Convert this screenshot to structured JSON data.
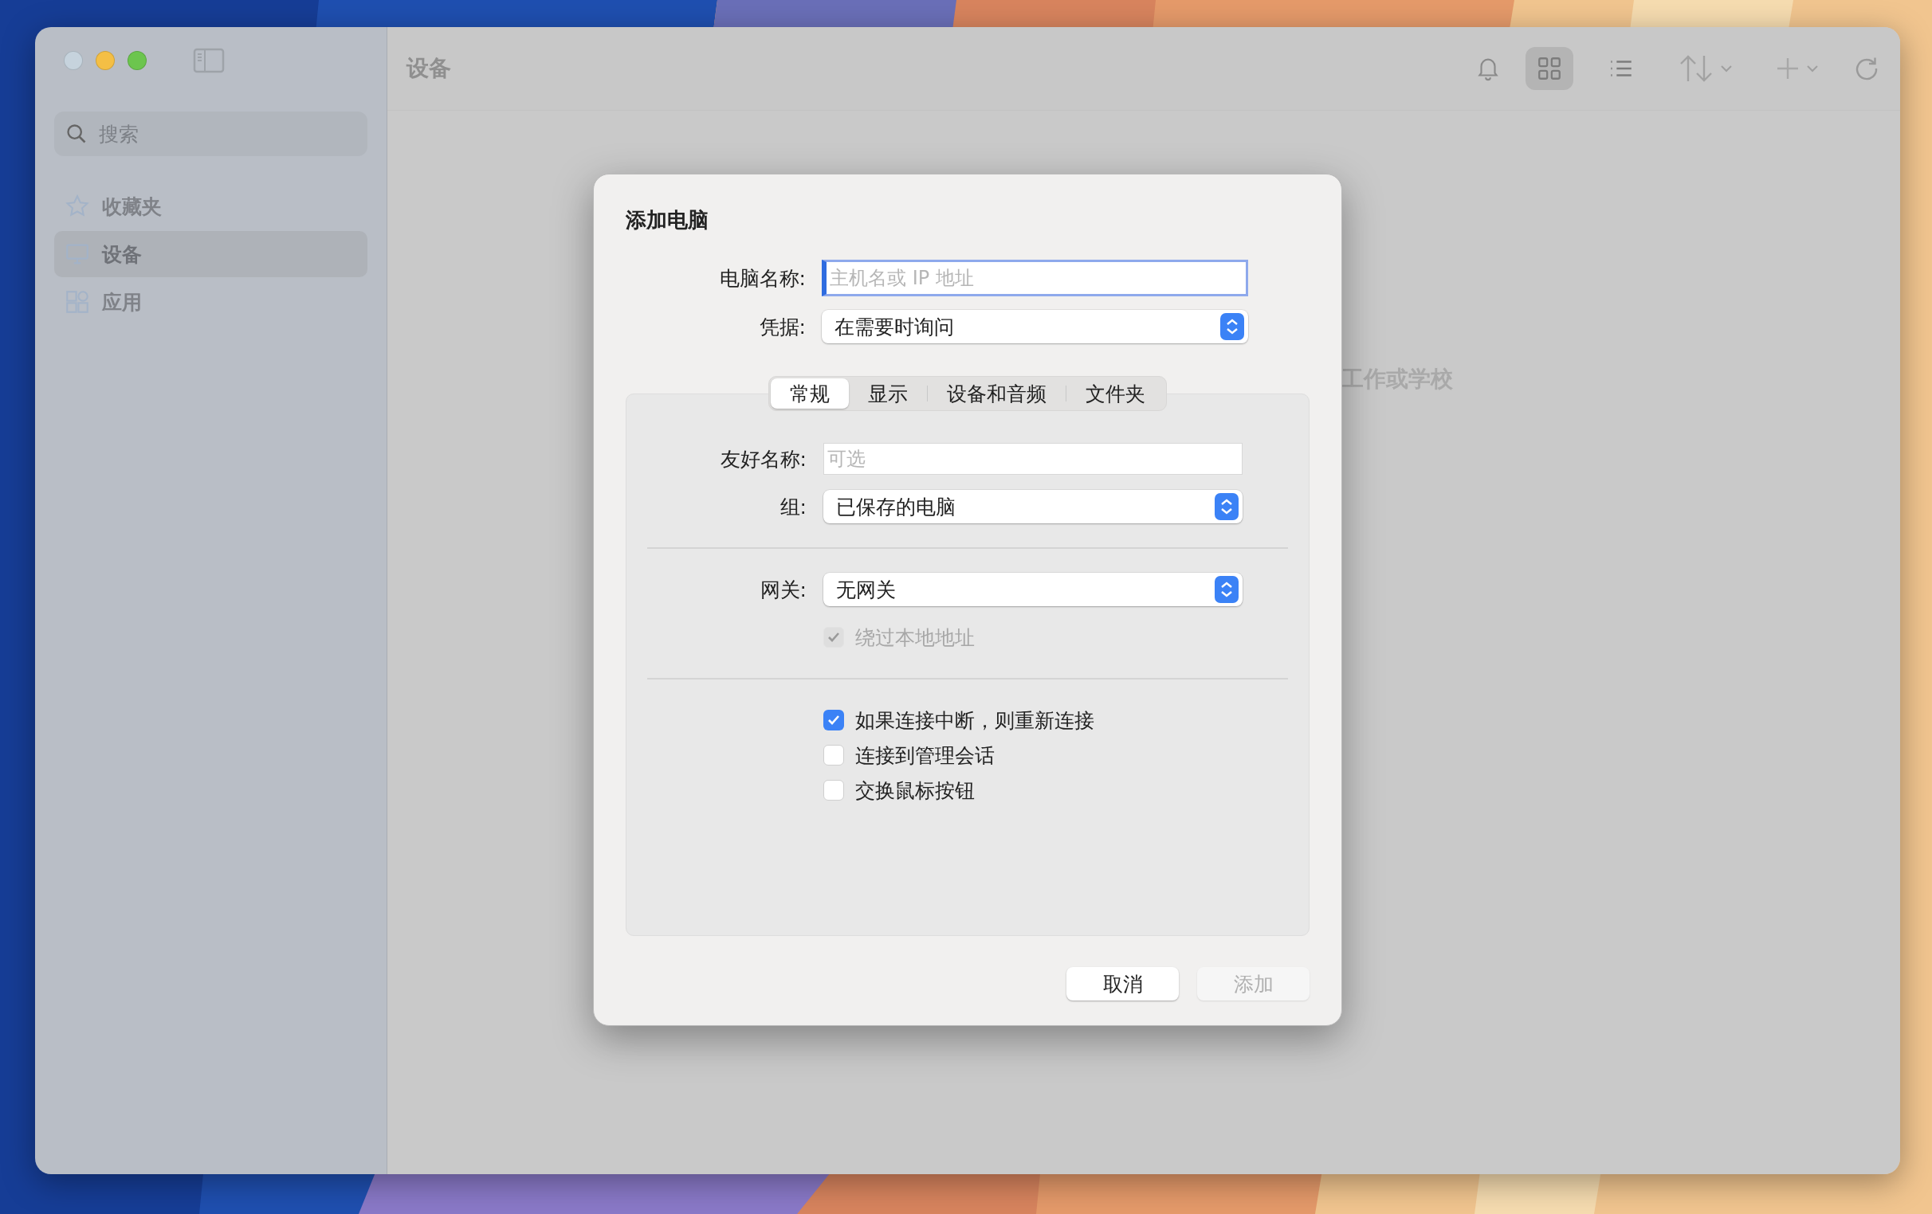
{
  "sidebar": {
    "search": {
      "placeholder": "搜索"
    },
    "items": [
      {
        "label": "收藏夹",
        "kind": "favorites",
        "selected": false
      },
      {
        "label": "设备",
        "kind": "devices",
        "selected": true
      },
      {
        "label": "应用",
        "kind": "apps",
        "selected": false
      }
    ]
  },
  "toolbar": {
    "title": "设备",
    "view_modes": [
      {
        "kind": "grid",
        "selected": true
      },
      {
        "kind": "list",
        "selected": false
      }
    ]
  },
  "empty_state_text": "工作或学校",
  "dialog": {
    "title": "添加电脑",
    "fields": [
      {
        "label": "电脑名称:",
        "kind": "text",
        "placeholder": "主机名或 IP 地址",
        "focused": true
      },
      {
        "label": "凭据:",
        "kind": "select",
        "value": "在需要时询问"
      }
    ],
    "tabs": [
      {
        "label": "常规",
        "selected": true
      },
      {
        "label": "显示",
        "selected": false
      },
      {
        "label": "设备和音频",
        "selected": false
      },
      {
        "label": "文件夹",
        "selected": false
      }
    ],
    "sections": [
      [
        {
          "label": "友好名称:",
          "kind": "text",
          "placeholder": "可选",
          "focused": false
        },
        {
          "label": "组:",
          "kind": "select",
          "value": "已保存的电脑"
        }
      ],
      [
        {
          "label": "网关:",
          "kind": "select",
          "value": "无网关"
        },
        {
          "label": "绕过本地地址",
          "kind": "checkbox",
          "checked": true,
          "disabled": true
        }
      ],
      [
        {
          "label": "如果连接中断，则重新连接",
          "kind": "checkbox",
          "checked": true,
          "disabled": false
        },
        {
          "label": "连接到管理会话",
          "kind": "checkbox",
          "checked": false,
          "disabled": false
        },
        {
          "label": "交换鼠标按钮",
          "kind": "checkbox",
          "checked": false,
          "disabled": false
        }
      ]
    ],
    "buttons": [
      {
        "label": "取消",
        "disabled": false
      },
      {
        "label": "添加",
        "disabled": true
      }
    ]
  }
}
